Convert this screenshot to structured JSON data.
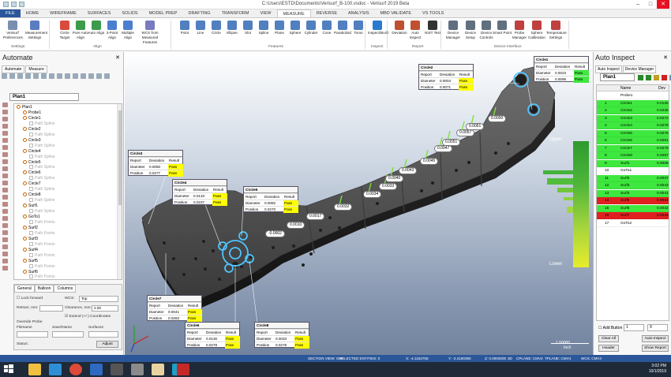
{
  "window": {
    "title": "C:\\Users\\ESTD\\Documents\\Verisurf_B-100.vsdoc - Verisurf 2019 Beta"
  },
  "tabs": [
    "FILE",
    "HOME",
    "WIREFRAME",
    "SURFACES",
    "SOLIDS",
    "MODEL PREP",
    "DRAFTING",
    "TRANSFORM",
    "VIEW",
    "MEASURE",
    "REVERSE",
    "ANALYSIS",
    "MBD VALIDATE",
    "VS TOOLS"
  ],
  "active_tab": "MEASURE",
  "ribbon": {
    "buttons": [
      {
        "label": "Verisurf Preferences",
        "color": "#7a8fb0"
      },
      {
        "label": "Measurement Settings",
        "color": "#5b7dc0"
      },
      {
        "label": "Circle Target",
        "color": "#d94b3c"
      },
      {
        "label": "Pure Auto Align",
        "color": "#3c9c4c"
      },
      {
        "label": "Auto Align",
        "color": "#3c9c4c"
      },
      {
        "label": "3-Point Align",
        "color": "#4a7fd0"
      },
      {
        "label": "Multiple Align",
        "color": "#4a7fd0"
      },
      {
        "label": "WCS from Measured Features",
        "color": "#7a7ac0"
      },
      {
        "label": "Point",
        "color": "#5080c0"
      },
      {
        "label": "Line",
        "color": "#5080c0"
      },
      {
        "label": "Circle",
        "color": "#5080c0"
      },
      {
        "label": "Ellipse",
        "color": "#5080c0"
      },
      {
        "label": "Slot",
        "color": "#5080c0"
      },
      {
        "label": "Spline",
        "color": "#5080c0"
      },
      {
        "label": "Plane",
        "color": "#5080c0"
      },
      {
        "label": "Sphere",
        "color": "#5080c0"
      },
      {
        "label": "Cylinder",
        "color": "#5080c0"
      },
      {
        "label": "Cone",
        "color": "#5080c0"
      },
      {
        "label": "Paraboloid",
        "color": "#5080c0"
      },
      {
        "label": "Torus",
        "color": "#5080c0"
      },
      {
        "label": "Inspect/Build",
        "color": "#2b7ad0"
      },
      {
        "label": "Deviation",
        "color": "#c05030"
      },
      {
        "label": "Auto Inspect",
        "color": "#c05030"
      },
      {
        "label": "NIST Test",
        "color": "#333333"
      },
      {
        "label": "Device Manager",
        "color": "#607080"
      },
      {
        "label": "Device Setup",
        "color": "#607080"
      },
      {
        "label": "Device Controls",
        "color": "#607080"
      },
      {
        "label": "Smart Point",
        "color": "#607080"
      },
      {
        "label": "Probe Manager",
        "color": "#c04040"
      },
      {
        "label": "Sphere Calibration",
        "color": "#c04040"
      },
      {
        "label": "Temperature Settings",
        "color": "#c04040"
      }
    ],
    "groups": [
      "Settings",
      "Align",
      "Features",
      "Inspect",
      "Report",
      "Device Interface"
    ]
  },
  "left_panel": {
    "title": "Automate",
    "subtabs": [
      "Automate",
      "Measure"
    ],
    "plan": "Plan1",
    "tree": [
      {
        "label": "Plan1",
        "sub": false,
        "indent": 0
      },
      {
        "label": "Probe1",
        "sub": false,
        "indent": 1
      },
      {
        "label": "Circle1",
        "sub": false,
        "indent": 1
      },
      {
        "label": "Path Spline",
        "sub": true,
        "indent": 2
      },
      {
        "label": "Circle2",
        "sub": false,
        "indent": 1
      },
      {
        "label": "Path Spline",
        "sub": true,
        "indent": 2
      },
      {
        "label": "Circle3",
        "sub": false,
        "indent": 1
      },
      {
        "label": "Path Spline",
        "sub": true,
        "indent": 2
      },
      {
        "label": "Circle4",
        "sub": false,
        "indent": 1
      },
      {
        "label": "Path Spline",
        "sub": true,
        "indent": 2
      },
      {
        "label": "Circle5",
        "sub": false,
        "indent": 1
      },
      {
        "label": "Path Spline",
        "sub": true,
        "indent": 2
      },
      {
        "label": "Circle6",
        "sub": false,
        "indent": 1
      },
      {
        "label": "Path Spline",
        "sub": true,
        "indent": 2
      },
      {
        "label": "Circle7",
        "sub": false,
        "indent": 1
      },
      {
        "label": "Path Spline",
        "sub": true,
        "indent": 2
      },
      {
        "label": "Circle8",
        "sub": false,
        "indent": 1
      },
      {
        "label": "Path Spline",
        "sub": true,
        "indent": 2
      },
      {
        "label": "Surf1",
        "sub": false,
        "indent": 1
      },
      {
        "label": "Path Spline",
        "sub": true,
        "indent": 2
      },
      {
        "label": "GoTo1",
        "sub": false,
        "indent": 1
      },
      {
        "label": "Path Points",
        "sub": true,
        "indent": 2
      },
      {
        "label": "Surf2",
        "sub": false,
        "indent": 1
      },
      {
        "label": "Path Points",
        "sub": true,
        "indent": 2
      },
      {
        "label": "Surf3",
        "sub": false,
        "indent": 1
      },
      {
        "label": "Path Points",
        "sub": true,
        "indent": 2
      },
      {
        "label": "Surf4",
        "sub": false,
        "indent": 1
      },
      {
        "label": "Path Points",
        "sub": true,
        "indent": 2
      },
      {
        "label": "Surf5",
        "sub": false,
        "indent": 1
      },
      {
        "label": "Path Points",
        "sub": true,
        "indent": 2
      },
      {
        "label": "Surf6",
        "sub": false,
        "indent": 1
      },
      {
        "label": "Path Points",
        "sub": true,
        "indent": 2
      }
    ],
    "props": {
      "tabs": [
        "General",
        "Balloon",
        "Columns"
      ],
      "lock_forward": "Lock forward",
      "wcs_label": "WCS:",
      "wcs_value": "Top",
      "retract_label": "Retract, mm:",
      "retract_value": "",
      "clearance_label": "Clearance, mm:",
      "clearance_value": "2.00",
      "extend_label": "Extend (+/-) Coordinates",
      "group_label": "Override Probe",
      "col_labels": [
        "Filename",
        "Save/Name",
        "Surfaces"
      ],
      "status_label": "Status:",
      "adjust_button": "Adjust"
    }
  },
  "right_panel": {
    "title": "Auto Inspect",
    "subtabs": [
      "Auto Inspect",
      "Device Manager"
    ],
    "plan": "Plan1",
    "columns": [
      "",
      "Name",
      "Dev"
    ],
    "rows": [
      {
        "idx": "",
        "name": "Probe1",
        "dev": "",
        "color": "#ffffff"
      },
      {
        "idx": "1",
        "name": "Circle1",
        "dev": "0.0125",
        "color": "#3ee83e"
      },
      {
        "idx": "2",
        "name": "Circle2",
        "dev": "0.0235",
        "color": "#3ee83e"
      },
      {
        "idx": "3",
        "name": "Circle3",
        "dev": "0.0272",
        "color": "#3ee83e"
      },
      {
        "idx": "4",
        "name": "Circle4",
        "dev": "0.0278",
        "color": "#3ee83e"
      },
      {
        "idx": "5",
        "name": "Circle5",
        "dev": "0.0276",
        "color": "#3ee83e"
      },
      {
        "idx": "6",
        "name": "Circle6",
        "dev": "0.0261",
        "color": "#3ee83e"
      },
      {
        "idx": "7",
        "name": "Circle7",
        "dev": "0.0279",
        "color": "#3ee83e"
      },
      {
        "idx": "8",
        "name": "Circle8",
        "dev": "0.0287",
        "color": "#3ee83e"
      },
      {
        "idx": "9",
        "name": "Surf1",
        "dev": "0.0006",
        "color": "#3ee83e"
      },
      {
        "idx": "10",
        "name": "GoTo1",
        "dev": "",
        "color": "#ffffff"
      },
      {
        "idx": "11",
        "name": "Surf2",
        "dev": "0.0037",
        "color": "#3ee83e"
      },
      {
        "idx": "12",
        "name": "Surf3",
        "dev": "0.0043",
        "color": "#3ee83e"
      },
      {
        "idx": "13",
        "name": "Surf4",
        "dev": "0.0041",
        "color": "#3ee83e"
      },
      {
        "idx": "14",
        "name": "Surf5",
        "dev": "0.0024",
        "color": "#e02020"
      },
      {
        "idx": "15",
        "name": "Surf6",
        "dev": "0.0032",
        "color": "#3ee83e"
      },
      {
        "idx": "16",
        "name": "Surf7",
        "dev": "0.0044",
        "color": "#e02020"
      },
      {
        "idx": "17",
        "name": "GoTo2",
        "dev": "",
        "color": "#ffffff"
      }
    ],
    "add_button_label": "Add Button",
    "add_from": "1",
    "add_to": "9",
    "buttons": [
      "Clear All",
      "Auto Inspect",
      "Header",
      "Show Report"
    ]
  },
  "viewport": {
    "upper_label": "Upper",
    "lower_label": "Lower",
    "scale_value": "1.00000",
    "scale_unit": "Inch",
    "callout_tables": [
      {
        "title": "Circle1",
        "header": [
          "Report",
          "Deviation",
          "Result"
        ],
        "rows": [
          [
            "Diameter",
            "0.0023",
            "Pass"
          ],
          [
            "Position",
            "0.0096",
            "Pass"
          ]
        ]
      },
      {
        "title": "Circle2",
        "header": [
          "Report",
          "Deviation",
          "Result"
        ],
        "rows": [
          [
            "Diameter",
            "0.0004",
            "Pass"
          ],
          [
            "Position",
            "0.0071",
            "Pass"
          ]
        ]
      },
      {
        "title": "Circle3",
        "header": [
          "Report",
          "Deviation",
          "Result"
        ],
        "rows": [
          [
            "Diameter",
            "0.0050",
            "Pass"
          ],
          [
            "Position",
            "0.0277",
            "Pass"
          ]
        ]
      },
      {
        "title": "Circle4",
        "header": [
          "Report",
          "Deviation",
          "Result"
        ],
        "rows": [
          [
            "Diameter",
            "0.0133",
            "Pass"
          ],
          [
            "Position",
            "0.0237",
            "Pass"
          ]
        ]
      },
      {
        "title": "Circle5",
        "header": [
          "Report",
          "Deviation",
          "Result"
        ],
        "rows": [
          [
            "Diameter",
            "0.0082",
            "Pass"
          ],
          [
            "Position",
            "0.0270",
            "Pass"
          ]
        ]
      },
      {
        "title": "Circle7",
        "header": [
          "Report",
          "Deviation",
          "Result"
        ],
        "rows": [
          [
            "Diameter",
            "0.0041",
            "Pass"
          ],
          [
            "Position",
            "0.0263",
            "Pass"
          ]
        ]
      },
      {
        "title": "Circle6",
        "header": [
          "Report",
          "Deviation",
          "Result"
        ],
        "rows": [
          [
            "Diameter",
            "0.0130",
            "Pass"
          ],
          [
            "Position",
            "0.0278",
            "Pass"
          ]
        ]
      },
      {
        "title": "Circle8",
        "header": [
          "Report",
          "Deviation",
          "Result"
        ],
        "rows": [
          [
            "Diameter",
            "0.0033",
            "Pass"
          ],
          [
            "Position",
            "0.0278",
            "Pass"
          ]
        ]
      }
    ],
    "dev_labels": [
      "0.0000",
      "0.0061",
      "0.0057",
      "0.0051",
      "0.0047",
      "0.0045",
      "0.0043",
      "0.0040",
      "0.0033",
      "0.0034",
      "0.0032",
      "0.0017",
      "0.0010",
      "-0.0002"
    ]
  },
  "statusbar": {
    "items": [
      "SECTION VIEW: OFF",
      "SELECTED ENTITIES: 0",
      "X: -4.1154755",
      "Y: -2.2180350",
      "Z: 0.0000000",
      "3D",
      "CPLANE: CMV4",
      "TPLANE: CMV4",
      "WCS: CMV4"
    ]
  },
  "taskbar": {
    "time": "3:02 PM",
    "date": "10/1/2019"
  }
}
